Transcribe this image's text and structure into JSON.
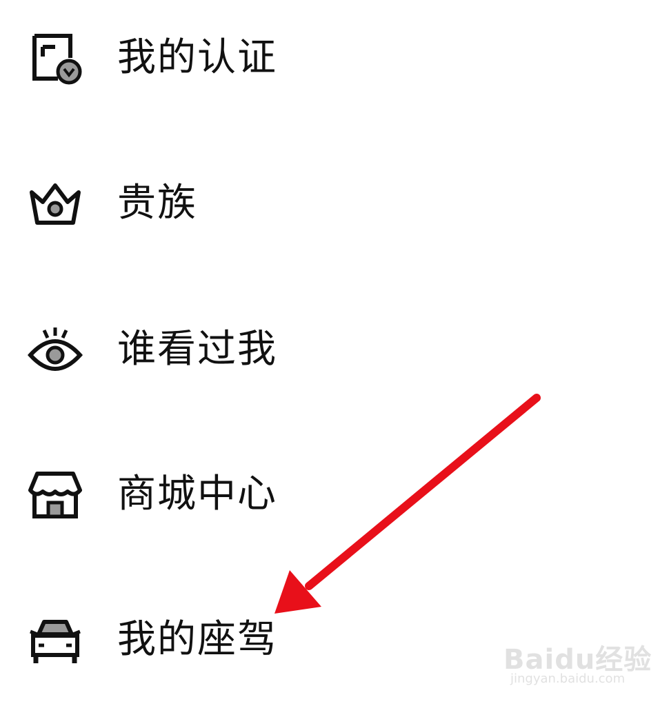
{
  "menu": {
    "items": [
      {
        "label": "我的认证",
        "icon": "certificate-icon"
      },
      {
        "label": "贵族",
        "icon": "crown-icon"
      },
      {
        "label": "谁看过我",
        "icon": "eye-icon"
      },
      {
        "label": "商城中心",
        "icon": "store-icon"
      },
      {
        "label": "我的座驾",
        "icon": "car-icon"
      }
    ]
  },
  "annotation": {
    "arrow_color": "#e8101a",
    "target": "我的座驾"
  },
  "watermark": {
    "brand": "Baidu经验",
    "url": "jingyan.baidu.com"
  },
  "colors": {
    "icon_stroke": "#111111",
    "icon_fill_gray": "#9a9a9a",
    "text": "#111111",
    "background": "#ffffff"
  }
}
